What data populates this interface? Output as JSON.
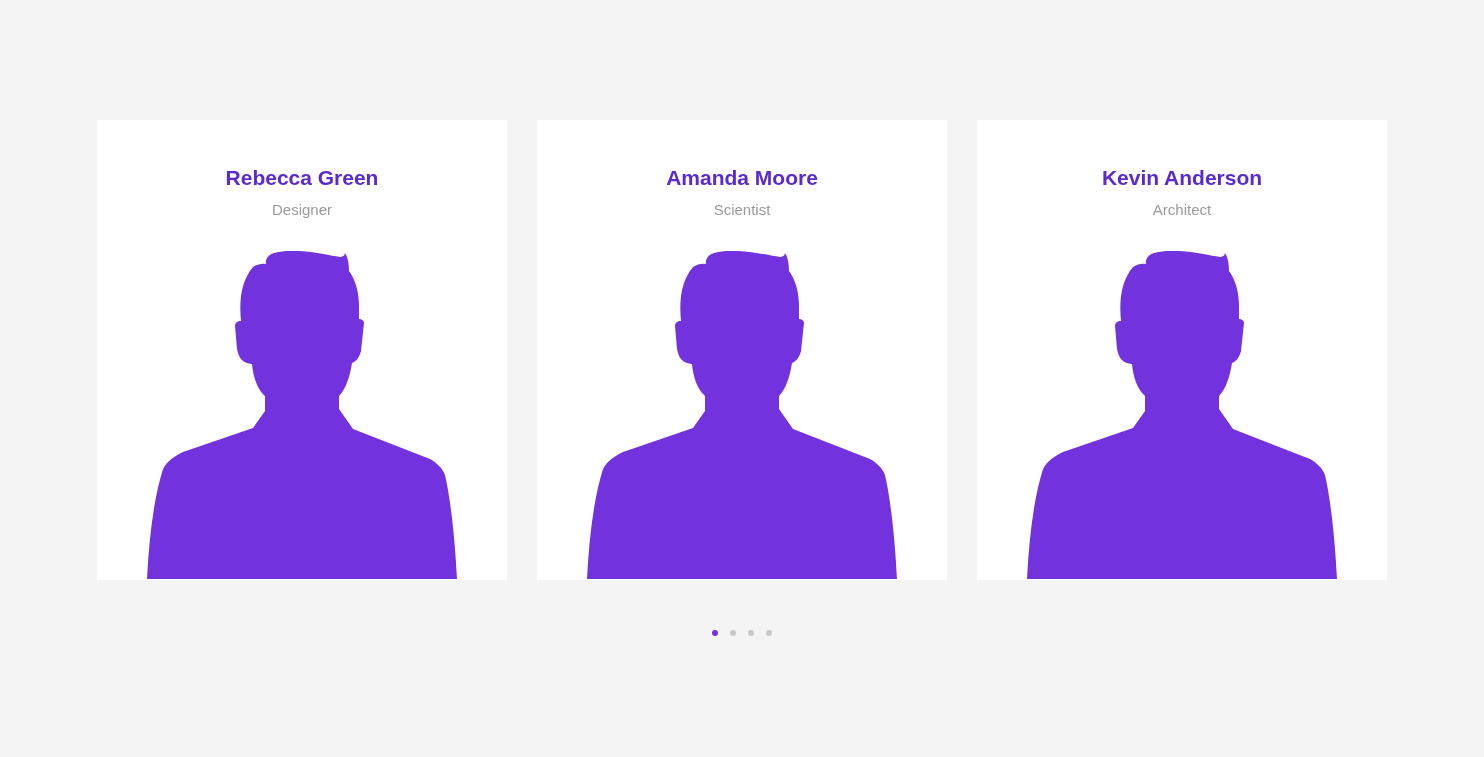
{
  "team": [
    {
      "name": "Rebecca Green",
      "role": "Designer"
    },
    {
      "name": "Amanda Moore",
      "role": "Scientist"
    },
    {
      "name": "Kevin Anderson",
      "role": "Architect"
    }
  ],
  "pagination": [
    {
      "selected": true
    },
    {
      "selected": false
    },
    {
      "selected": false
    },
    {
      "selected": false
    }
  ]
}
